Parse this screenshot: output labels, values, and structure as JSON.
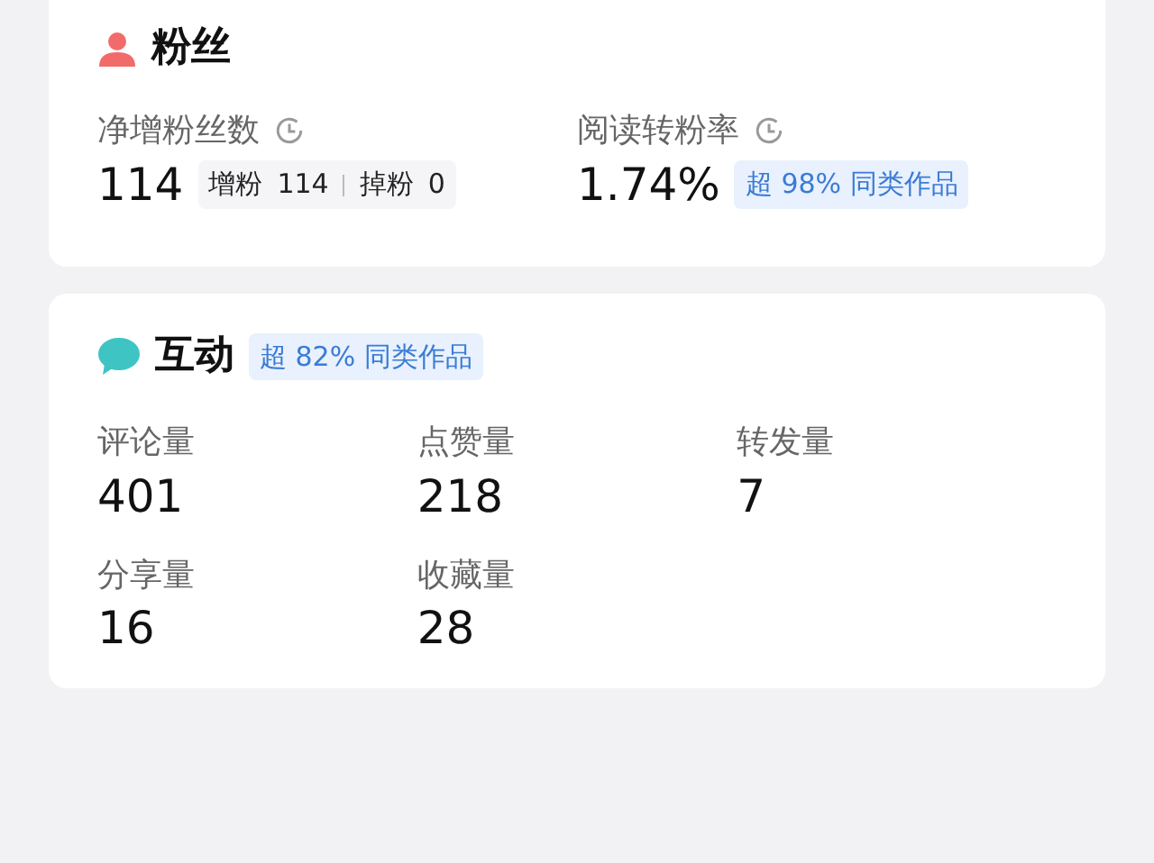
{
  "fans": {
    "title": "粉丝",
    "metrics": [
      {
        "label": "净增粉丝数",
        "value": "114",
        "breakdown": [
          {
            "label": "增粉",
            "value": "114"
          },
          {
            "label": "掉粉",
            "value": "0"
          }
        ]
      },
      {
        "label": "阅读转粉率",
        "value": "1.74%",
        "badge": "超 98% 同类作品"
      }
    ]
  },
  "interaction": {
    "title": "互动",
    "badge": "超 82% 同类作品",
    "stats": [
      {
        "label": "评论量",
        "value": "401"
      },
      {
        "label": "点赞量",
        "value": "218"
      },
      {
        "label": "转发量",
        "value": "7"
      },
      {
        "label": "分享量",
        "value": "16"
      },
      {
        "label": "收藏量",
        "value": "28"
      }
    ]
  }
}
